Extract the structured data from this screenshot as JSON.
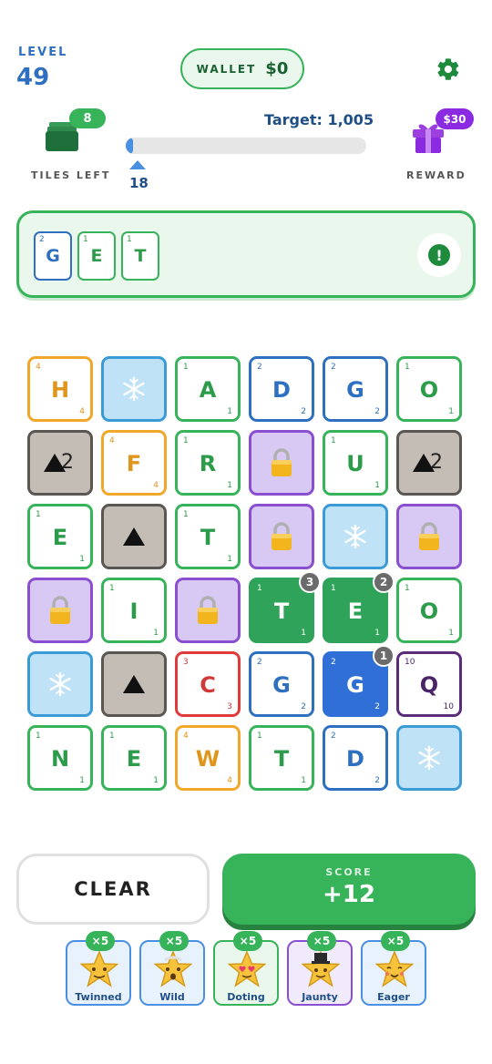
{
  "header": {
    "level_label": "LEVEL",
    "level_value": "49",
    "wallet_label": "WALLET",
    "wallet_value": "$0",
    "tiles_left_count": "8",
    "tiles_left_label": "TILES LEFT",
    "target_text": "Target: 1,005",
    "progress_marker": "18",
    "progress_fraction": 0.018,
    "reward_badge": "$30",
    "reward_label": "REWARD"
  },
  "current_word": [
    {
      "letter": "G",
      "score": "2",
      "color": "blue"
    },
    {
      "letter": "E",
      "score": "1",
      "color": "green"
    },
    {
      "letter": "T",
      "score": "1",
      "color": "green"
    }
  ],
  "info_button": "!",
  "board": [
    [
      {
        "t": "letter",
        "l": "H",
        "s": "4",
        "c": "orange"
      },
      {
        "t": "ice"
      },
      {
        "t": "letter",
        "l": "A",
        "s": "1",
        "c": "green"
      },
      {
        "t": "letter",
        "l": "D",
        "s": "2",
        "c": "blueb"
      },
      {
        "t": "letter",
        "l": "G",
        "s": "2",
        "c": "blueb"
      },
      {
        "t": "letter",
        "l": "O",
        "s": "1",
        "c": "green"
      }
    ],
    [
      {
        "t": "rock",
        "n": "2"
      },
      {
        "t": "letter",
        "l": "F",
        "s": "4",
        "c": "orange"
      },
      {
        "t": "letter",
        "l": "R",
        "s": "1",
        "c": "green"
      },
      {
        "t": "lock"
      },
      {
        "t": "letter",
        "l": "U",
        "s": "1",
        "c": "green"
      },
      {
        "t": "rock",
        "n": "2"
      }
    ],
    [
      {
        "t": "letter",
        "l": "E",
        "s": "1",
        "c": "green"
      },
      {
        "t": "rock",
        "n": ""
      },
      {
        "t": "letter",
        "l": "T",
        "s": "1",
        "c": "green"
      },
      {
        "t": "lock"
      },
      {
        "t": "ice"
      },
      {
        "t": "lock"
      }
    ],
    [
      {
        "t": "lock"
      },
      {
        "t": "letter",
        "l": "I",
        "s": "1",
        "c": "green"
      },
      {
        "t": "lock"
      },
      {
        "t": "letter",
        "l": "T",
        "s": "1",
        "c": "selg",
        "order": "3"
      },
      {
        "t": "letter",
        "l": "E",
        "s": "1",
        "c": "selg",
        "order": "2"
      },
      {
        "t": "letter",
        "l": "O",
        "s": "1",
        "c": "green"
      }
    ],
    [
      {
        "t": "ice"
      },
      {
        "t": "rock",
        "n": ""
      },
      {
        "t": "letter",
        "l": "C",
        "s": "3",
        "c": "red"
      },
      {
        "t": "letter",
        "l": "G",
        "s": "2",
        "c": "blueb"
      },
      {
        "t": "letter",
        "l": "G",
        "s": "2",
        "c": "selb",
        "order": "1"
      },
      {
        "t": "letter",
        "l": "Q",
        "s": "10",
        "c": "purpleb"
      }
    ],
    [
      {
        "t": "letter",
        "l": "N",
        "s": "1",
        "c": "green"
      },
      {
        "t": "letter",
        "l": "E",
        "s": "1",
        "c": "green"
      },
      {
        "t": "letter",
        "l": "W",
        "s": "4",
        "c": "orange"
      },
      {
        "t": "letter",
        "l": "T",
        "s": "1",
        "c": "green"
      },
      {
        "t": "letter",
        "l": "D",
        "s": "2",
        "c": "blueb"
      },
      {
        "t": "ice"
      }
    ]
  ],
  "actions": {
    "clear_label": "CLEAR",
    "score_label": "SCORE",
    "score_value": "+12"
  },
  "powerups": [
    {
      "name": "Twinned",
      "mult": "×5",
      "color": "blue"
    },
    {
      "name": "Wild",
      "mult": "×5",
      "color": "blue"
    },
    {
      "name": "Doting",
      "mult": "×5",
      "color": "green"
    },
    {
      "name": "Jaunty",
      "mult": "×5",
      "color": "purple"
    },
    {
      "name": "Eager",
      "mult": "×5",
      "color": "blue"
    }
  ],
  "icons": {
    "settings": "gear-icon",
    "tiles_stack": "tiles-stack-icon",
    "reward": "gift-icon",
    "ice": "snowflake-icon",
    "lock": "lock-icon",
    "rock": "triangle-icon"
  },
  "colors": {
    "green": "#37b35a",
    "blue": "#2f6fc0",
    "orange": "#f0a72a",
    "purple": "#8a4fd0",
    "red": "#e03a3a"
  }
}
